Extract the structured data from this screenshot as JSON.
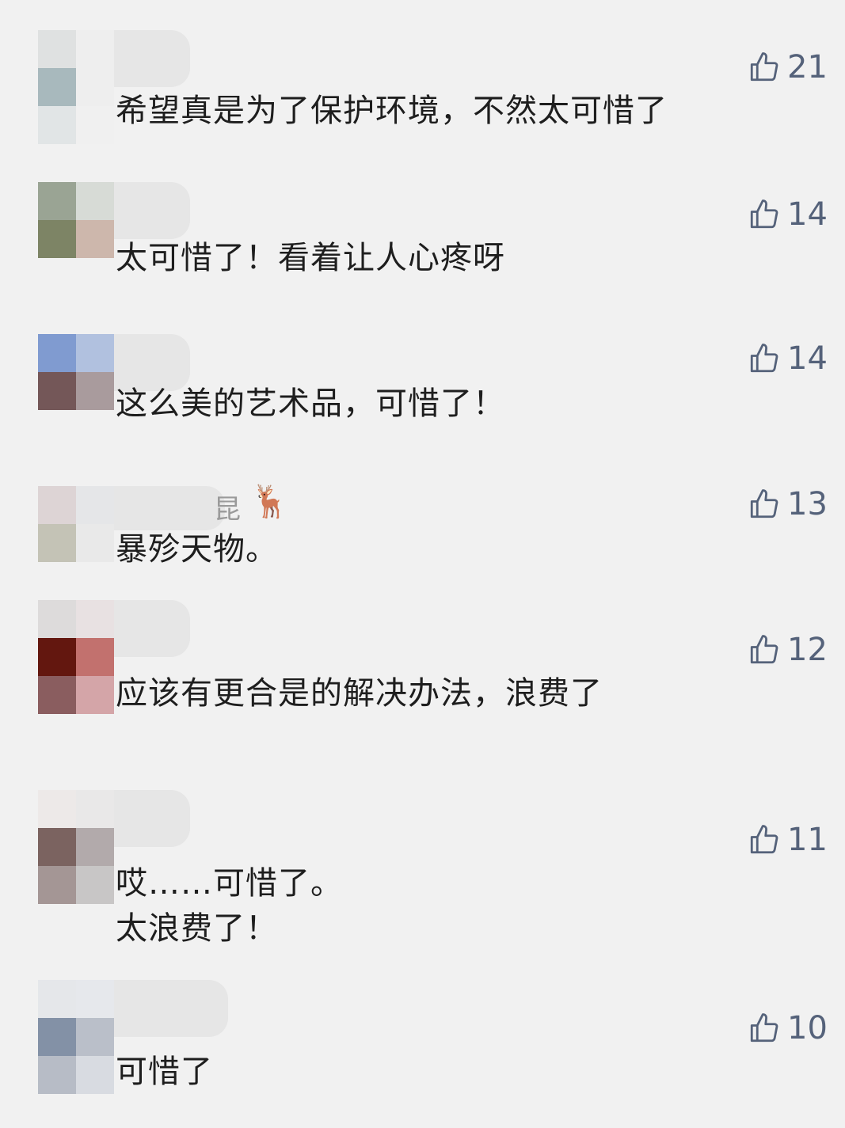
{
  "comments": [
    {
      "text_lines": [
        "希望真是为了保护环境，不然太可惜了"
      ],
      "likes": "21",
      "avatar": [
        "#dfe1e1",
        "#eeeeee",
        "#a8b9bd",
        "#eeeeee",
        "#e1e5e6",
        "#f0f0f0"
      ]
    },
    {
      "text_lines": [
        "太可惜了！看着让人心疼呀"
      ],
      "likes": "14",
      "avatar": [
        "#9aa494",
        "#d7dbd6",
        "#7d8465",
        "#cdb7ac",
        "#f1f1f1",
        "#f1f1f1"
      ]
    },
    {
      "text_lines": [
        "这么美的艺术品，可惜了！"
      ],
      "likes": "14",
      "avatar": [
        "#809bd0",
        "#b1c1df",
        "#745758",
        "#a99b9d",
        "#f1f1f1",
        "#f1f1f1"
      ]
    },
    {
      "text_lines": [
        "暴殄天物。"
      ],
      "likes": "13",
      "name_fragment": "昆",
      "name_emoji": "🦌",
      "avatar": [
        "#ddd4d5",
        "#e5e6e8",
        "#c4c3b6",
        "#e9e9e9",
        "#f1f1f1",
        "#f1f1f1"
      ]
    },
    {
      "text_lines": [
        "应该有更合是的解决办法，浪费了"
      ],
      "likes": "12",
      "avatar": [
        "#dddbdb",
        "#e8e1e2",
        "#63170f",
        "#c2716e",
        "#8a5d5f",
        "#d4a5a8"
      ]
    },
    {
      "text_lines": [
        "哎……可惜了。",
        "太浪费了！"
      ],
      "likes": "11",
      "avatar": [
        "#ede9e8",
        "#e9e8e8",
        "#7b6360",
        "#b2aaab",
        "#a49695",
        "#c8c6c6"
      ]
    },
    {
      "text_lines": [
        "可惜了"
      ],
      "likes": "10",
      "avatar": [
        "#e5e7ea",
        "#e6e8ec",
        "#8391a6",
        "#babfc9",
        "#b7bcc6",
        "#d8dbe1"
      ]
    }
  ],
  "icons": {
    "like": "thumbs-up-icon",
    "emoji": "deer-emoji"
  },
  "colors": {
    "background": "#f1f1f1",
    "like_count": "#55627a",
    "text": "#1e1e1e"
  }
}
